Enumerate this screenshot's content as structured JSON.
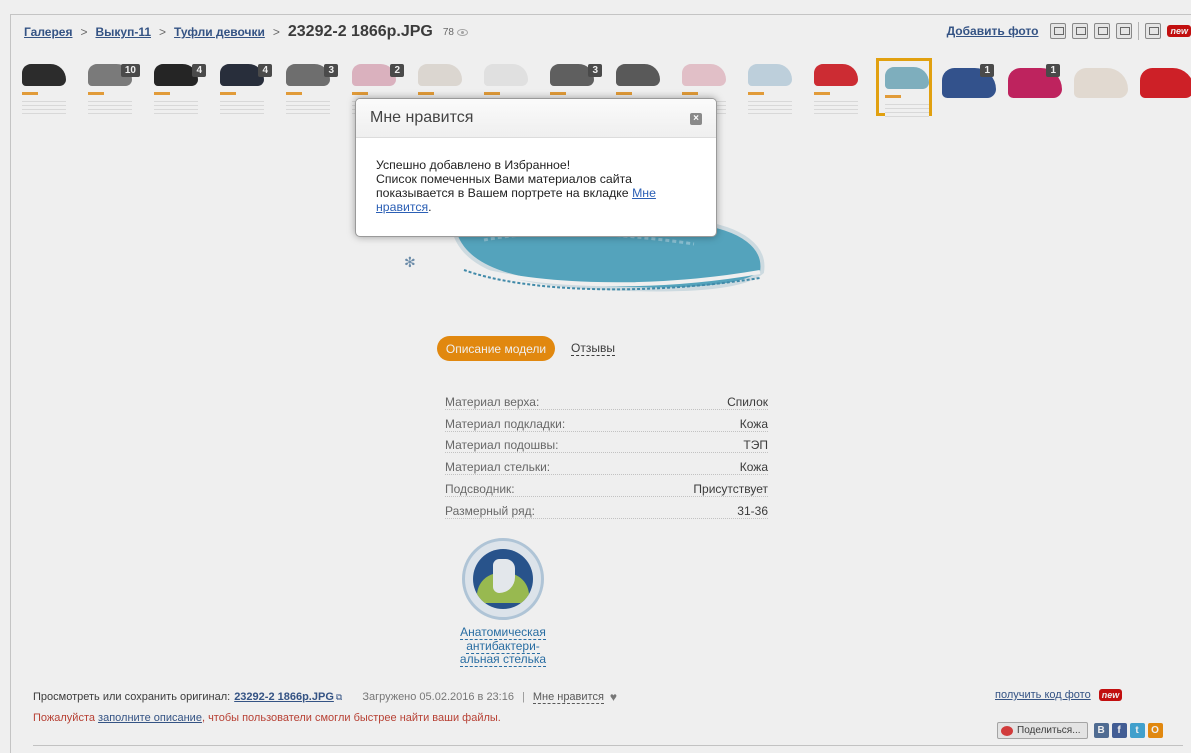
{
  "breadcrumb": {
    "items": [
      "Галерея",
      "Выкуп-11",
      "Туфли девочки"
    ],
    "separator": ">",
    "title": "23292-2 1866p.JPG",
    "views": "78"
  },
  "toolbar": {
    "add_photo": "Добавить фото",
    "new_badge": "new"
  },
  "thumbnails": [
    {
      "color": "#222222",
      "count": ""
    },
    {
      "color": "#7a7a7a",
      "count": "10"
    },
    {
      "color": "#1a1a1a",
      "count": "4"
    },
    {
      "color": "#1d2433",
      "count": "4"
    },
    {
      "color": "#6d6d6d",
      "count": "3"
    },
    {
      "color": "#e8b9c8",
      "count": "2"
    },
    {
      "color": "#e9e3dc",
      "count": ""
    },
    {
      "color": "#eeeeee",
      "count": ""
    },
    {
      "color": "#5c5c5c",
      "count": "3"
    },
    {
      "color": "#555555",
      "count": ""
    },
    {
      "color": "#f0c9d2",
      "count": ""
    },
    {
      "color": "#c7dbe9",
      "count": ""
    },
    {
      "color": "#d8222a",
      "count": ""
    },
    {
      "color": "#7fb6c6",
      "count": "",
      "active": true
    },
    {
      "color": "#2a4d8f",
      "count": "1",
      "big": true
    },
    {
      "color": "#c8175a",
      "count": "1",
      "big": true
    },
    {
      "color": "#efe6dc",
      "count": "",
      "big": true
    },
    {
      "color": "#d9141c",
      "count": "",
      "big": true
    }
  ],
  "tabs": {
    "description": "Описание модели",
    "reviews": "Отзывы"
  },
  "specs": [
    {
      "key": "Материал верха:",
      "value": "Спилок"
    },
    {
      "key": "Материал подкладки:",
      "value": "Кожа"
    },
    {
      "key": "Материал подошвы:",
      "value": "ТЭП"
    },
    {
      "key": "Материал стельки:",
      "value": "Кожа"
    },
    {
      "key": "Подсводник:",
      "value": "Присутствует"
    },
    {
      "key": "Размерный ряд:",
      "value": "31-36"
    }
  ],
  "badge": {
    "line1": "Анатомическая",
    "line2": "антибактери-",
    "line3": "альная стелька"
  },
  "footer": {
    "view_original": "Просмотреть или сохранить оригинал:",
    "original_link": "23292-2 1866p.JPG",
    "loaded": "Загружено 05.02.2016 в 23:16",
    "pipe": "|",
    "like": "Мне нравится",
    "please": "Пожалуйста",
    "fill_desc": "заполните описание",
    "please_rest": ", чтобы пользователи смогли быстрее найти ваши файлы.",
    "get_code": "получить код фото",
    "new_badge": "new",
    "share": "Поделиться...",
    "social": [
      "В",
      "f",
      "t",
      "О"
    ]
  },
  "modal": {
    "title": "Мне нравится",
    "close": "×",
    "line1": "Успешно добавлено в Избранное!",
    "line2": "Список помеченных Вами материалов сайта",
    "line3": "показывается в Вашем портрете на вкладке",
    "link": "Мне нравится",
    "end": "."
  }
}
